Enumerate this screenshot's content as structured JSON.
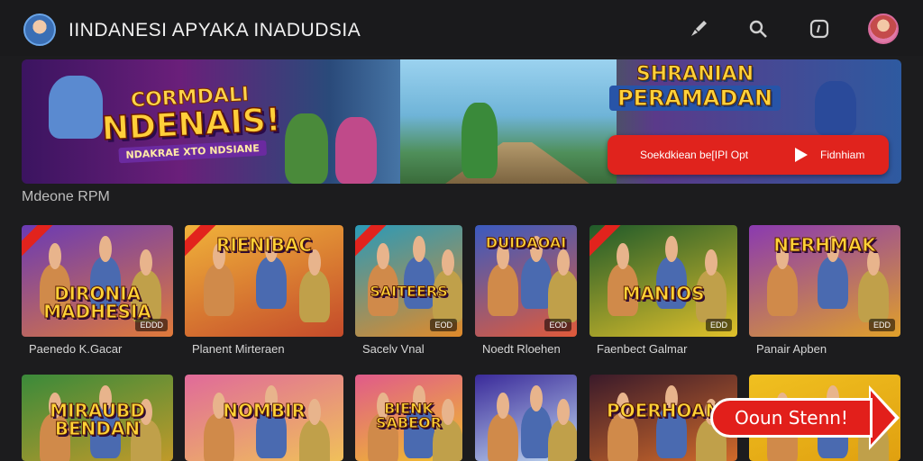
{
  "header": {
    "title": "IINDANESI APYAKA INADUDSIA",
    "icons": [
      "brush-icon",
      "search-icon",
      "chat-icon"
    ]
  },
  "banner": {
    "left_logo_top": "CORMDALI",
    "left_logo_main": "NDENAIS!",
    "left_logo_sub": "NDAKRAE XTO NDSIANE",
    "right_logo_top": "SHRANIAN",
    "right_logo_main": "PERAMADAN",
    "cta_text": "Soekdkiean be[IPI Opt",
    "cta_side_text": "Fidnhiam"
  },
  "section_label": "Mdeone RPM",
  "games": [
    {
      "title_art": "DIRONIA MADHESIA",
      "caption": "Paenedo K.Gacar",
      "badge": "EDDD",
      "ribbon": true,
      "colors": [
        "#6a3ab5",
        "#e07a3a"
      ]
    },
    {
      "title_art": "RIENIBAC",
      "caption": "Planent Mirteraen",
      "badge": "",
      "ribbon": true,
      "colors": [
        "#f0b23a",
        "#c44a2a"
      ]
    },
    {
      "title_art": "SAITEERS",
      "caption": "Sacelv Vnal",
      "badge": "EOD",
      "ribbon": true,
      "colors": [
        "#2a9ab8",
        "#e08a2a"
      ]
    },
    {
      "title_art": "DUIDAOAI",
      "caption": "Noedt Rloehen",
      "badge": "EOD",
      "ribbon": false,
      "colors": [
        "#3a5ac0",
        "#e05a3a"
      ]
    },
    {
      "title_art": "MANIOS",
      "caption": "Faenbect Galmar",
      "badge": "EDD",
      "ribbon": true,
      "colors": [
        "#1f5a2a",
        "#e0c02a"
      ]
    },
    {
      "title_art": "NERHMAK",
      "caption": "Panair Apben",
      "badge": "EDD",
      "ribbon": false,
      "colors": [
        "#8a3ab0",
        "#e0a02a"
      ]
    },
    {
      "title_art": "MIRAUBD BENDAN",
      "caption": "",
      "badge": "",
      "ribbon": false,
      "colors": [
        "#3a8a3a",
        "#c09a2a"
      ]
    },
    {
      "title_art": "NOMBIR",
      "caption": "",
      "badge": "",
      "ribbon": false,
      "colors": [
        "#e06a9a",
        "#f0c05a"
      ]
    },
    {
      "title_art": "BIENK SABEOR",
      "caption": "",
      "badge": "",
      "ribbon": false,
      "colors": [
        "#e05a8a",
        "#f0c02a"
      ]
    },
    {
      "title_art": "",
      "caption": "",
      "badge": "",
      "ribbon": false,
      "colors": [
        "#3a2a9a",
        "#c0d8f0"
      ]
    },
    {
      "title_art": "POERHOAN",
      "caption": "",
      "badge": "",
      "ribbon": false,
      "colors": [
        "#3a1a2a",
        "#d06a2a"
      ]
    },
    {
      "title_art": "",
      "caption": "",
      "badge": "",
      "ribbon": false,
      "colors": [
        "#f0c020",
        "#e0a010"
      ]
    }
  ],
  "bottom_cta": {
    "label": "Ooun Stenn!"
  },
  "accent_red": "#e2231d"
}
